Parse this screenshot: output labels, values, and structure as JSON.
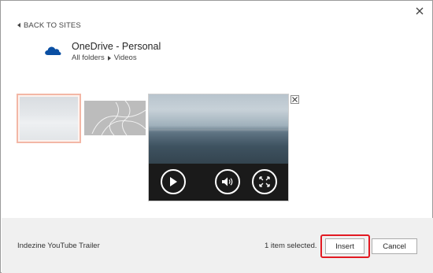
{
  "nav": {
    "back_label": "BACK TO SITES"
  },
  "site": {
    "name": "OneDrive - Personal",
    "breadcrumb": [
      "All folders",
      "Videos"
    ]
  },
  "icons": {
    "close": "close-icon",
    "back": "chevron-left-icon",
    "site": "cloud-icon",
    "breadcrumb_separator": "chevron-right-icon",
    "play": "play-icon",
    "volume": "volume-icon",
    "fullscreen": "fullscreen-icon",
    "preview_close": "close-icon"
  },
  "footer": {
    "selected_title": "Indezine YouTube Trailer",
    "status": "1 item selected.",
    "insert_label": "Insert",
    "cancel_label": "Cancel"
  },
  "colors": {
    "brand_onedrive": "#0a4fa3",
    "selection_border": "#f3b7a6",
    "highlight_annotation": "#e21a22",
    "footer_bg": "#f0f0f0"
  }
}
